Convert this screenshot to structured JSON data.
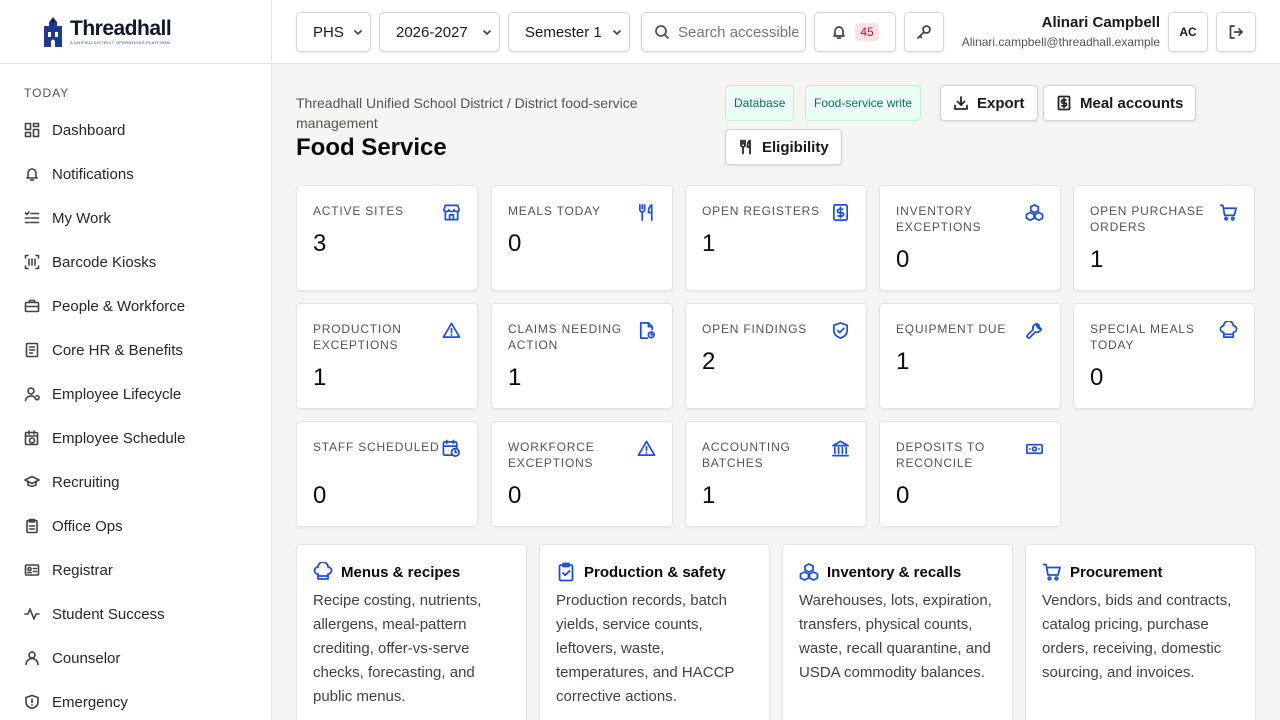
{
  "brand": {
    "name": "Threadhall",
    "tagline": "A unified district operations platform"
  },
  "sidebar": {
    "section": "Today",
    "items": [
      {
        "label": "Dashboard"
      },
      {
        "label": "Notifications"
      },
      {
        "label": "My Work"
      },
      {
        "label": "Barcode Kiosks"
      },
      {
        "label": "People & Workforce"
      },
      {
        "label": "Core HR & Benefits"
      },
      {
        "label": "Employee Lifecycle"
      },
      {
        "label": "Employee Schedule"
      },
      {
        "label": "Recruiting"
      },
      {
        "label": "Office Ops"
      },
      {
        "label": "Registrar"
      },
      {
        "label": "Student Success"
      },
      {
        "label": "Counselor"
      },
      {
        "label": "Emergency"
      }
    ]
  },
  "header": {
    "school": "PHS",
    "year": "2026-2027",
    "term": "Semester 1",
    "search_placeholder": "Search accessible records",
    "notifications_count": "45",
    "user_name": "Alinari Campbell",
    "user_email": "Alinari.campbell@threadhall.example",
    "avatar_initials": "AC"
  },
  "page": {
    "breadcrumb": "Threadhall Unified School District / District food-service management",
    "title": "Food Service",
    "tags": [
      "Database",
      "Food-service write"
    ],
    "buttons": {
      "export": "Export",
      "meal_accounts": "Meal accounts",
      "eligibility": "Eligibility"
    }
  },
  "stats": [
    {
      "label": "Active sites",
      "value": "3",
      "icon": "store-icon"
    },
    {
      "label": "Meals today",
      "value": "0",
      "icon": "utensils-icon"
    },
    {
      "label": "Open registers",
      "value": "1",
      "icon": "receipt-dollar-icon"
    },
    {
      "label": "Inventory exceptions",
      "value": "0",
      "icon": "boxes-icon"
    },
    {
      "label": "Open purchase orders",
      "value": "1",
      "icon": "cart-icon"
    },
    {
      "label": "Production exceptions",
      "value": "1",
      "icon": "warning-icon"
    },
    {
      "label": "Claims needing action",
      "value": "1",
      "icon": "file-clock-icon"
    },
    {
      "label": "Open findings",
      "value": "2",
      "icon": "shield-check-icon"
    },
    {
      "label": "Equipment due",
      "value": "1",
      "icon": "wrench-icon"
    },
    {
      "label": "Special meals today",
      "value": "0",
      "icon": "chef-hat-icon"
    },
    {
      "label": "Staff scheduled",
      "value": "0",
      "icon": "calendar-clock-icon"
    },
    {
      "label": "Workforce exceptions",
      "value": "0",
      "icon": "warning-icon"
    },
    {
      "label": "Accounting batches",
      "value": "1",
      "icon": "bank-icon"
    },
    {
      "label": "Deposits to reconcile",
      "value": "0",
      "icon": "banknote-icon"
    }
  ],
  "modules": [
    {
      "title": "Menus & recipes",
      "desc": "Recipe costing, nutrients, allergens, meal-pattern crediting, offer-vs-serve checks, forecasting, and public menus."
    },
    {
      "title": "Production & safety",
      "desc": "Production records, batch yields, service counts, leftovers, waste, temperatures, and HACCP corrective actions."
    },
    {
      "title": "Inventory & recalls",
      "desc": "Warehouses, lots, expiration, transfers, physical counts, waste, recall quarantine, and USDA commodity balances."
    },
    {
      "title": "Procurement",
      "desc": "Vendors, bids and contracts, catalog pricing, purchase orders, receiving, domestic sourcing, and invoices."
    }
  ]
}
